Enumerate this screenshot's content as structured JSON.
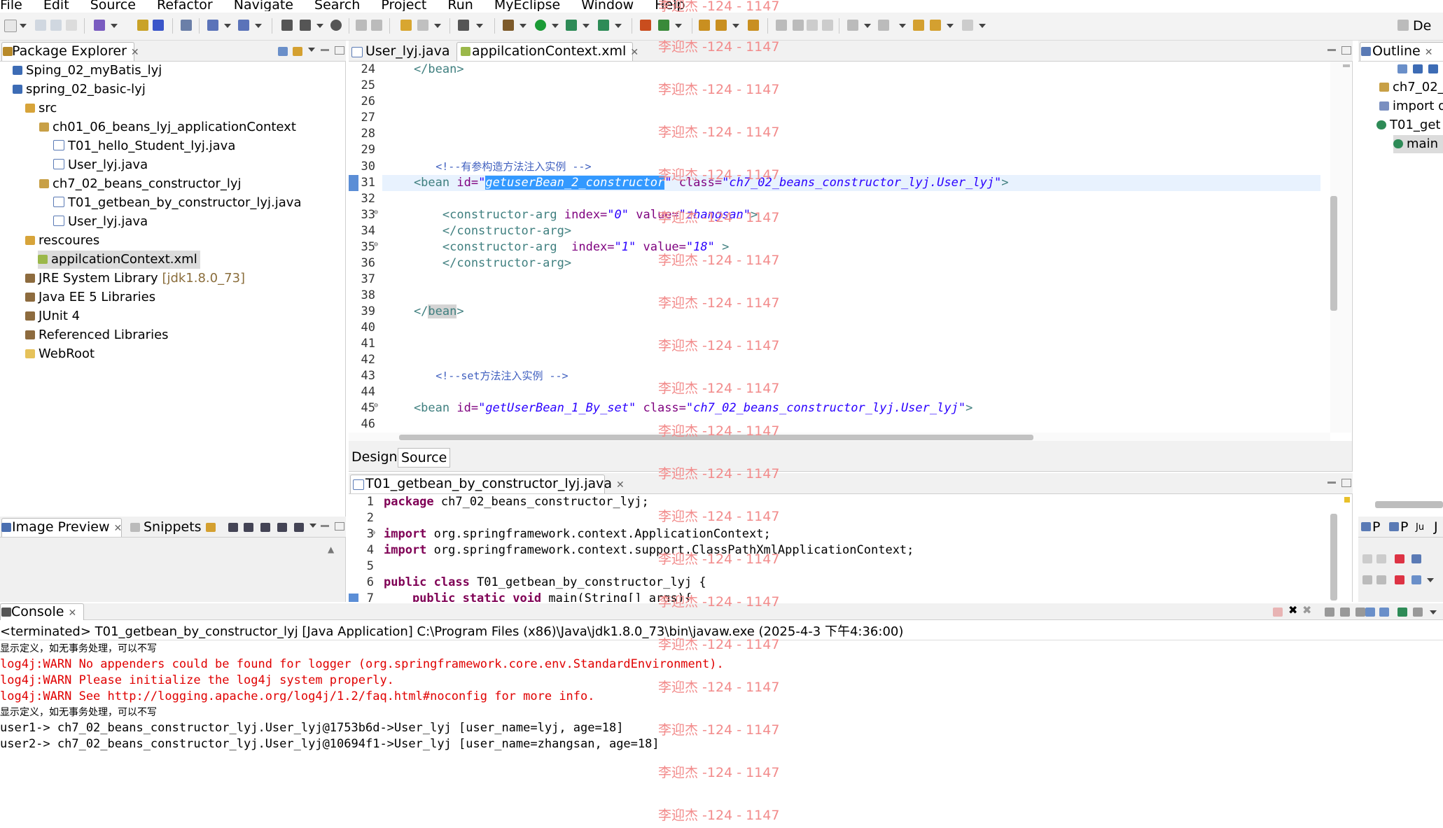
{
  "menu": [
    "File",
    "Edit",
    "Source",
    "Refactor",
    "Navigate",
    "Search",
    "Project",
    "Run",
    "MyEclipse",
    "Window",
    "Help"
  ],
  "perspective_label": "De",
  "watermark": "李迎杰 -124 - 1147",
  "package_explorer": {
    "title": "Package Explorer",
    "items": [
      {
        "label": "Sping_02_myBatis_lyj"
      },
      {
        "label": "spring_02_basic-lyj"
      },
      {
        "label": "src"
      },
      {
        "label": "ch01_06_beans_lyj_applicationContext"
      },
      {
        "label": "T01_hello_Student_lyj.java"
      },
      {
        "label": "User_lyj.java"
      },
      {
        "label": "ch7_02_beans_constructor_lyj"
      },
      {
        "label": "T01_getbean_by_constructor_lyj.java"
      },
      {
        "label": "User_lyj.java"
      },
      {
        "label": "rescoures"
      },
      {
        "label": "appilcationContext.xml"
      },
      {
        "label": "JRE System Library",
        "suffix": "[jdk1.8.0_73]"
      },
      {
        "label": "Java EE 5 Libraries"
      },
      {
        "label": "JUnit 4"
      },
      {
        "label": "Referenced Libraries"
      },
      {
        "label": "WebRoot"
      }
    ]
  },
  "xml_editor": {
    "tabs": [
      "User_lyj.java",
      "appilcationContext.xml"
    ],
    "line_numbers": [
      "24",
      "25",
      "26",
      "27",
      "28",
      "29",
      "30",
      "31",
      "32",
      "33",
      "34",
      "35",
      "36",
      "37",
      "38",
      "39",
      "40",
      "41",
      "42",
      "43",
      "44",
      "45",
      "46"
    ],
    "bottom_tabs": [
      "Design",
      "Source"
    ]
  },
  "java_editor": {
    "tab": "T01_getbean_by_constructor_lyj.java",
    "line_numbers": [
      "1",
      "2",
      "3",
      "4",
      "5",
      "6",
      "7"
    ],
    "lines": {
      "l1a": "package",
      "l1b": " ch7_02_beans_constructor_lyj;",
      "l3a": "import",
      "l3b": " org.springframework.context.ApplicationContext;",
      "l4a": "import",
      "l4b": " org.springframework.context.support.ClassPathXmlApplicationContext;",
      "l6a": "public class",
      "l6b": " T01_getbean_by_constructor_lyj {",
      "l7a": "    public static void",
      "l7b": " main(String[] args){"
    }
  },
  "xml_text": {
    "l24": "    </bean>",
    "l30": "        <!--有参构造方法注入实例 -->",
    "l31_tag": "    <bean",
    "l31_attr1": " id=",
    "l31_val1a": "\"",
    "l31_sel": "getuserBean_2_constructor",
    "l31_val1b": "\"",
    "l31_attr2": " class=",
    "l31_val2": "\"ch7_02_beans_constructor_lyj.User_lyj\"",
    "l31_end": ">",
    "l33_tag": "        <constructor-arg",
    "l33_attr1": " index=",
    "l33_val1": "\"0\"",
    "l33_attr2": " value=",
    "l33_val2": "\"zhangsan\"",
    "l33_end": ">",
    "l34": "        </constructor-arg>",
    "l35_tag": "        <constructor-arg",
    "l35_attr1": "  index=",
    "l35_val1": "\"1\"",
    "l35_attr2": " value=",
    "l35_val2": "\"18\"",
    "l35_end": " >",
    "l36": "        </constructor-arg>",
    "l39a": "    </",
    "l39b": "bean",
    "l39c": ">",
    "l43": "        <!--set方法注入实例 -->",
    "l45_tag": "    <bean",
    "l45_attr1": " id=",
    "l45_val1": "\"getUserBean_1_By_set\"",
    "l45_attr2": " class=",
    "l45_val2": "\"ch7_02_beans_constructor_lyj.User_lyj\"",
    "l45_end": ">"
  },
  "outline": {
    "title": "Outline",
    "items": [
      "ch7_02_",
      "import d",
      "T01_get",
      "main"
    ]
  },
  "image_preview": {
    "title": "Image Preview",
    "snippets": "Snippets"
  },
  "right_mini_tabs": [
    "P",
    "P",
    "Ju",
    "J"
  ],
  "console": {
    "title": "Console",
    "header": "<terminated> T01_getbean_by_constructor_lyj [Java Application] C:\\Program Files (x86)\\Java\\jdk1.8.0_73\\bin\\javaw.exe (2025-4-3 下午4:36:00)",
    "lines": [
      {
        "text": "显示定义，如无事务处理，可以不写",
        "style": "cn"
      },
      {
        "text": "log4j:WARN No appenders could be found for logger (org.springframework.core.env.StandardEnvironment).",
        "style": "red"
      },
      {
        "text": "log4j:WARN Please initialize the log4j system properly.",
        "style": "red"
      },
      {
        "text": "log4j:WARN See http://logging.apache.org/log4j/1.2/faq.html#noconfig for more info.",
        "style": "red"
      },
      {
        "text": "显示定义，如无事务处理，可以不写",
        "style": "cn"
      },
      {
        "text": "user1-> ch7_02_beans_constructor_lyj.User_lyj@1753b6d->User_lyj [user_name=lyj, age=18]",
        "style": "black"
      },
      {
        "text": "user2-> ch7_02_beans_constructor_lyj.User_lyj@10694f1->User_lyj [user_name=zhangsan, age=18]",
        "style": "black"
      }
    ]
  },
  "colors": {
    "selection": "#3399ff",
    "current_line": "#e8f2fe",
    "watermark": "#f28b8b",
    "console_error": "#e00000"
  }
}
